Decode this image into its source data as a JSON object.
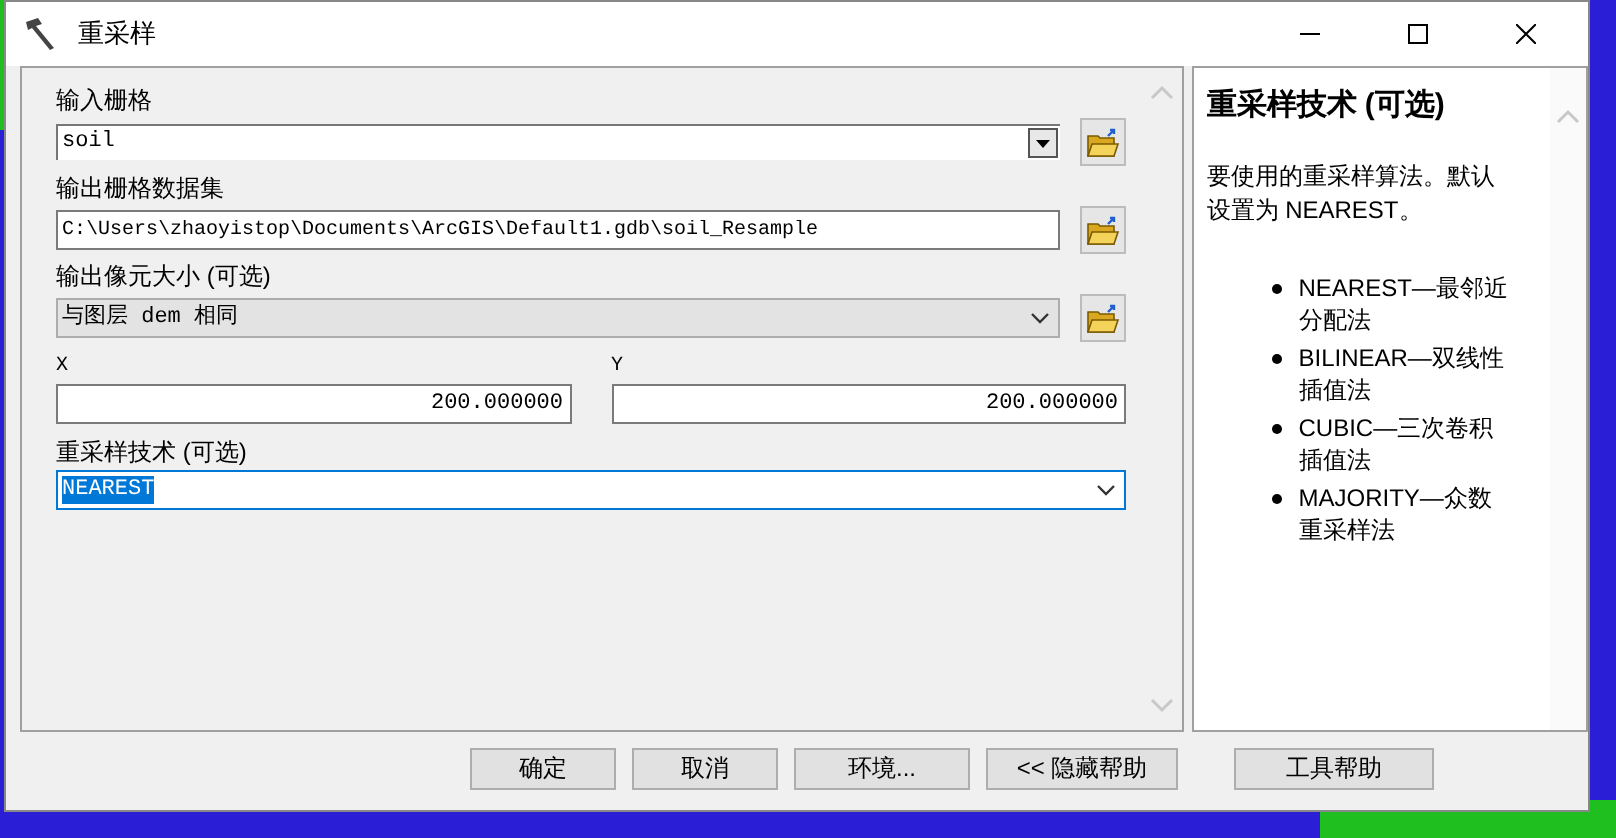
{
  "window": {
    "title": "重采样"
  },
  "fields": [
    {
      "kind": "classic-combo",
      "label": "输入栅格",
      "value": "soil",
      "browse": true
    },
    {
      "kind": "text",
      "label": "输出栅格数据集",
      "value": "C:\\Users\\zhaoyistop\\Documents\\ArcGIS\\Default1.gdb\\soil_Resample",
      "browse": true
    },
    {
      "kind": "select",
      "label": "输出像元大小 (可选)",
      "value": "与图层 dem 相同",
      "browse": true,
      "focused": false
    },
    {
      "kind": "xy",
      "items": [
        {
          "label": "X",
          "value": "200.000000"
        },
        {
          "label": "Y",
          "value": "200.000000"
        }
      ]
    },
    {
      "kind": "select",
      "label": "重采样技术 (可选)",
      "value": "NEAREST",
      "browse": false,
      "focused": true
    }
  ],
  "help": {
    "title": "重采样技术 (可选)",
    "intro": "要使用的重采样算法。默认设置为 NEAREST。",
    "items": [
      "NEAREST—最邻近分配法",
      "BILINEAR—双线性插值法",
      "CUBIC—三次卷积插值法",
      "MAJORITY—众数重采样法"
    ]
  },
  "buttons": [
    "确定",
    "取消",
    "环境...",
    "<< 隐藏帮助",
    "工具帮助"
  ]
}
